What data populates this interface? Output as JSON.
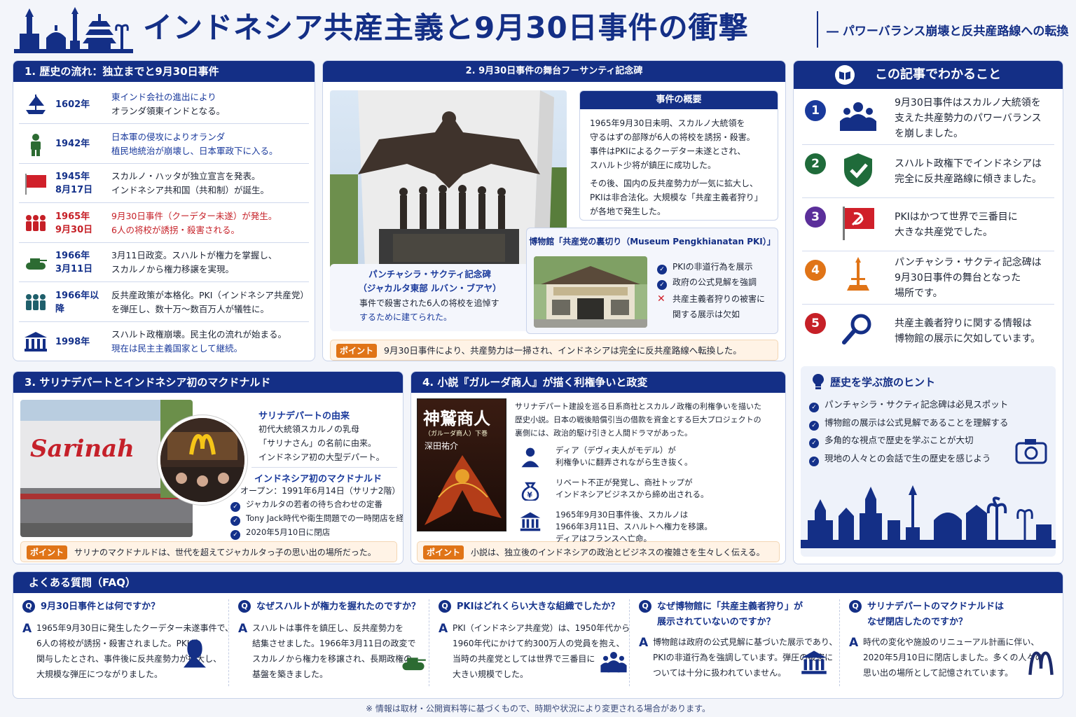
{
  "header": {
    "title": "インドネシア共産主義と9月30日事件の衝撃",
    "subtitle": "― パワーバランス崩壊と反共産路線への転換"
  },
  "timeline": {
    "heading": "1. 歴史の流れ：独立までと9月30日事件",
    "rows": [
      {
        "year1": "1602年",
        "year2": "",
        "line1": "東インド会社の進出により",
        "line2": "オランダ領東インドとなる。",
        "icon": "ship-icon"
      },
      {
        "year1": "1942年",
        "year2": "",
        "line1": "日本軍の侵攻によりオランダ",
        "line2": "植民地統治が崩壊し、日本軍政下に入る。",
        "icon": "soldier-icon"
      },
      {
        "year1": "1945年",
        "year2": "8月17日",
        "line1": "スカルノ・ハッタが独立宣言を発表。",
        "line2": "インドネシア共和国（共和制）が誕生。",
        "icon": "flag-icon"
      },
      {
        "year1": "1965年",
        "year2": "9月30日",
        "line1": "9月30日事件（クーデター未遂）が発生。",
        "line2": "6人の将校が誘拐・殺害される。",
        "icon": "people-icon"
      },
      {
        "year1": "1966年",
        "year2": "3月11日",
        "line1": "3月11日政変。スハルトが権力を掌握し、",
        "line2": "スカルノから権力移譲を実現。",
        "icon": "tank-icon"
      },
      {
        "year1": "1966年以降",
        "year2": "",
        "line1": "反共産政策が本格化。PKI（インドネシア共産党）",
        "line2": "を弾圧し、数十万〜数百万人が犠牲に。",
        "icon": "crowd-icon"
      },
      {
        "year1": "1998年",
        "year2": "",
        "line1": "スハルト政権崩壊。民主化の流れが始まる。",
        "line2": "現在は民主主義国家として継続。",
        "icon": "building-icon"
      }
    ]
  },
  "monument": {
    "heading": "2. 9月30日事件の舞台フ－サンティ記念碑",
    "caption_title1": "パンチャシラ・サクティ記念碑",
    "caption_title2": "（ジャカルタ東部 ルバン・ブアヤ）",
    "caption_text1": "事件で殺害された6人の将校を追悼す",
    "caption_text2": "するために建てられた。",
    "overview_heading": "事件の概要",
    "overview_p1": [
      "1965年9月30日未明、スカルノ大統領を",
      "守るはずの部隊が6人の将校を誘拐・殺害。",
      "事件はPKIによるクーデター未遂とされ、",
      "スハルト少将が鎮圧に成功した。"
    ],
    "overview_p2": [
      "その後、国内の反共産勢力が一気に拡大し、",
      "PKIは非合法化。大規模な「共産主義者狩り」",
      "が各地で発生した。"
    ],
    "museum_heading": "博物館「共産党の裏切り（Museum Pengkhianatan PKI）」",
    "museum_checks": [
      "PKIの非道行為を展示",
      "政府の公式見解を強調"
    ],
    "museum_cross1": "共産主義者狩りの被害に",
    "museum_cross2": "関する展示は欠如",
    "point_label": "ポイント",
    "point_text": "9月30日事件により、共産勢力は一掃され、インドネシアは完全に反共産路線へ転換した。"
  },
  "summary": {
    "heading": "この記事でわかること",
    "items": [
      {
        "num": "1",
        "color": "#1a3a9c",
        "line1": "9月30日事件はスカルノ大統領を",
        "line2": "支えた共産勢力のパワーバランス",
        "line3": "を崩しました。",
        "icon": "group-icon"
      },
      {
        "num": "2",
        "color": "#1f6b3a",
        "line1": "スハルト政権下でインドネシアは",
        "line2": "完全に反共産路線に傾きました。",
        "line3": "",
        "icon": "shield-check-icon"
      },
      {
        "num": "3",
        "color": "#5b2f9a",
        "line1": "PKIはかつて世界で三番目に",
        "line2": "大きな共産党でした。",
        "line3": "",
        "icon": "hammer-sickle-flag-icon"
      },
      {
        "num": "4",
        "color": "#e07417",
        "line1": "パンチャシラ・サクティ記念碑は",
        "line2": "9月30日事件の舞台となった",
        "line3": "場所です。",
        "icon": "monument-icon"
      },
      {
        "num": "5",
        "color": "#c62027",
        "line1": "共産主義者狩りに関する情報は",
        "line2": "博物館の展示に欠如しています。",
        "line3": "",
        "icon": "magnifier-icon"
      }
    ],
    "tips_heading": "歴史を学ぶ旅のヒント",
    "tips": [
      "パンチャシラ・サクティ記念碑は必見スポット",
      "博物館の展示は公式見解であることを理解する",
      "多角的な視点で歴史を学ぶことが大切",
      "現地の人々との会話で生の歴史を感じよう"
    ]
  },
  "sarinah": {
    "heading": "3. サリナデパートとインドネシア初のマクドナルド",
    "sign": "Sarinah",
    "origin_heading": "サリナデパートの由来",
    "origin": [
      "初代大統領スカルノの乳母",
      "「サリナさん」の名前に由来。",
      "インドネシア初の大型デパート。"
    ],
    "mcd_heading": "インドネシア初のマクドナルド",
    "mcd_open": "オープン：1991年6月14日（サリナ2階）",
    "mcd_checks": [
      "ジャカルタの若者の待ち合わせの定番",
      "Tony Jack時代や衛生問題での一時閉店を経て、",
      "2020年5月10日に閉店"
    ],
    "point_label": "ポイント",
    "point_text": "サリナのマクドナルドは、世代を超えてジャカルタっ子の思い出の場所だった。"
  },
  "novel": {
    "heading": "4. 小説『ガルーダ商人』が描く利権争いと政変",
    "book_title": "神鷲商人",
    "book_sub": "（ガルーダ商人）下巻",
    "book_author": "深田祐介",
    "intro": [
      "サリナデパート建設を巡る日系商社とスカルノ政権の利権争いを描いた",
      "歴史小説。日本の戦後賠償引当の借款を資金とする巨大プロジェクトの",
      "裏側には、政治的駆け引きと人間ドラマがあった。"
    ],
    "items": [
      {
        "line1": "ディア（デヴィ夫人がモデル）が",
        "line2": "利権争いに翻弄されながら生き抜く。",
        "line3": "",
        "icon": "person-icon"
      },
      {
        "line1": "リベート不正が発覚し、商社トップが",
        "line2": "インドネシアビジネスから締め出される。",
        "line3": "",
        "icon": "money-bag-icon"
      },
      {
        "line1": "1965年9月30日事件後、スカルノは",
        "line2": "1966年3月11日、スハルトへ権力を移譲。",
        "line3": "ディアはフランスへ亡命。",
        "icon": "government-icon"
      }
    ],
    "point_label": "ポイント",
    "point_text": "小説は、独立後のインドネシアの政治とビジネスの複雑さを生々しく伝える。"
  },
  "faq": {
    "heading": "よくある質問（FAQ）",
    "items": [
      {
        "q1": "9月30日事件とは何ですか？",
        "q2": "",
        "a": [
          "1965年9月30日に発生したクーデター未遂事件で、",
          "6人の将校が誘拐・殺害されました。PKIが",
          "関与したとされ、事件後に反共産勢力が拡大し、",
          "大規模な弾圧につながりました。"
        ]
      },
      {
        "q1": "なぜスハルトが権力を握れたのですか？",
        "q2": "",
        "a": [
          "スハルトは事件を鎮圧し、反共産勢力を",
          "結集させました。1966年3月11日の政変で",
          "スカルノから権力を移譲され、長期政権の",
          "基盤を築きました。"
        ]
      },
      {
        "q1": "PKIはどれくらい大きな組織でしたか？",
        "q2": "",
        "a": [
          "PKI（インドネシア共産党）は、1950年代から",
          "1960年代にかけて約300万人の党員を抱え、",
          "当時の共産党としては世界で三番目に",
          "大きい規模でした。"
        ]
      },
      {
        "q1": "なぜ博物館に「共産主義者狩り」が",
        "q2": "展示されていないのですか？",
        "a": [
          "博物館は政府の公式見解に基づいた展示であり、",
          "PKIの非道行為を強調しています。弾圧の被害に",
          "ついては十分に扱われていません。"
        ]
      },
      {
        "q1": "サリナデパートのマクドナルドは",
        "q2": "なぜ閉店したのですか？",
        "a": [
          "時代の変化や施設のリニューアル計画に伴い、",
          "2020年5月10日に閉店しました。多くの人々の",
          "思い出の場所として記憶されています。"
        ]
      }
    ]
  },
  "footer": "※ 情報は取材・公開資料等に基づくもので、時期や状況により変更される場合があります。",
  "colors": {
    "navy": "#142f86",
    "orange": "#e07417",
    "red": "#c62027"
  }
}
